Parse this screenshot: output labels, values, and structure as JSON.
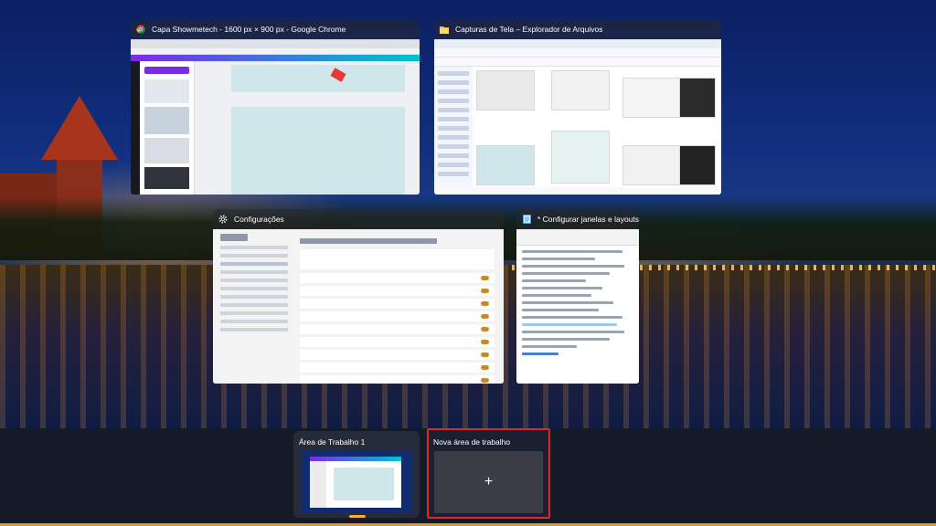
{
  "windows": [
    {
      "id": "chrome",
      "title": "Capa Showmetech - 1600 px × 900 px - Google Chrome",
      "icon": "chrome-icon"
    },
    {
      "id": "explorer",
      "title": "Capturas de Tela – Explorador de Arquivos",
      "icon": "folder-icon"
    },
    {
      "id": "settings",
      "title": "Configurações",
      "icon": "gear-icon"
    },
    {
      "id": "notepad",
      "title": "* Configurar janelas e layouts c...",
      "icon": "notepad-icon"
    }
  ],
  "desktops": [
    {
      "label": "Área de Trabalho 1",
      "active": true
    },
    {
      "label": "Nova área de trabalho",
      "is_new": true,
      "plus_symbol": "+"
    }
  ],
  "colors": {
    "accent": "#f0b323",
    "highlight_border": "#e4242a",
    "bar_background": "#151a28"
  }
}
